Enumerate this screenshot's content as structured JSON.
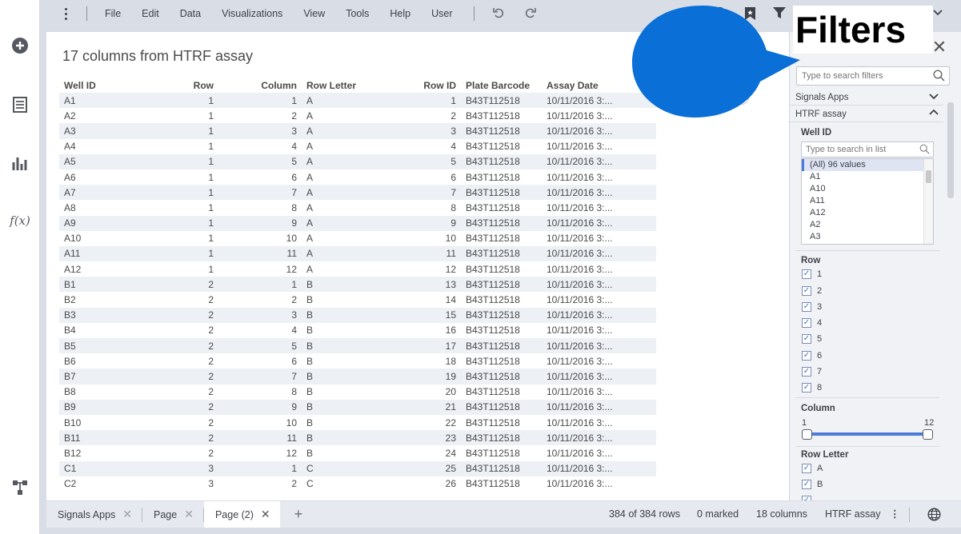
{
  "menubar": {
    "menus": [
      "File",
      "Edit",
      "Data",
      "Visualizations",
      "View",
      "Tools",
      "Help",
      "User"
    ]
  },
  "window": {
    "title": "17 columns from HTRF assay"
  },
  "table": {
    "columns": [
      "Well ID",
      "Row",
      "Column",
      "Row Letter",
      "Row ID",
      "Plate Barcode",
      "Assay Date"
    ],
    "rows": [
      [
        "A1",
        "1",
        "1",
        "A",
        "1",
        "B43T112518",
        "10/11/2016 3:..."
      ],
      [
        "A2",
        "1",
        "2",
        "A",
        "2",
        "B43T112518",
        "10/11/2016 3:..."
      ],
      [
        "A3",
        "1",
        "3",
        "A",
        "3",
        "B43T112518",
        "10/11/2016 3:..."
      ],
      [
        "A4",
        "1",
        "4",
        "A",
        "4",
        "B43T112518",
        "10/11/2016 3:..."
      ],
      [
        "A5",
        "1",
        "5",
        "A",
        "5",
        "B43T112518",
        "10/11/2016 3:..."
      ],
      [
        "A6",
        "1",
        "6",
        "A",
        "6",
        "B43T112518",
        "10/11/2016 3:..."
      ],
      [
        "A7",
        "1",
        "7",
        "A",
        "7",
        "B43T112518",
        "10/11/2016 3:..."
      ],
      [
        "A8",
        "1",
        "8",
        "A",
        "8",
        "B43T112518",
        "10/11/2016 3:..."
      ],
      [
        "A9",
        "1",
        "9",
        "A",
        "9",
        "B43T112518",
        "10/11/2016 3:..."
      ],
      [
        "A10",
        "1",
        "10",
        "A",
        "10",
        "B43T112518",
        "10/11/2016 3:..."
      ],
      [
        "A11",
        "1",
        "11",
        "A",
        "11",
        "B43T112518",
        "10/11/2016 3:..."
      ],
      [
        "A12",
        "1",
        "12",
        "A",
        "12",
        "B43T112518",
        "10/11/2016 3:..."
      ],
      [
        "B1",
        "2",
        "1",
        "B",
        "13",
        "B43T112518",
        "10/11/2016 3:..."
      ],
      [
        "B2",
        "2",
        "2",
        "B",
        "14",
        "B43T112518",
        "10/11/2016 3:..."
      ],
      [
        "B3",
        "2",
        "3",
        "B",
        "15",
        "B43T112518",
        "10/11/2016 3:..."
      ],
      [
        "B4",
        "2",
        "4",
        "B",
        "16",
        "B43T112518",
        "10/11/2016 3:..."
      ],
      [
        "B5",
        "2",
        "5",
        "B",
        "17",
        "B43T112518",
        "10/11/2016 3:..."
      ],
      [
        "B6",
        "2",
        "6",
        "B",
        "18",
        "B43T112518",
        "10/11/2016 3:..."
      ],
      [
        "B7",
        "2",
        "7",
        "B",
        "19",
        "B43T112518",
        "10/11/2016 3:..."
      ],
      [
        "B8",
        "2",
        "8",
        "B",
        "20",
        "B43T112518",
        "10/11/2016 3:..."
      ],
      [
        "B9",
        "2",
        "9",
        "B",
        "21",
        "B43T112518",
        "10/11/2016 3:..."
      ],
      [
        "B10",
        "2",
        "10",
        "B",
        "22",
        "B43T112518",
        "10/11/2016 3:..."
      ],
      [
        "B11",
        "2",
        "11",
        "B",
        "23",
        "B43T112518",
        "10/11/2016 3:..."
      ],
      [
        "B12",
        "2",
        "12",
        "B",
        "24",
        "B43T112518",
        "10/11/2016 3:..."
      ],
      [
        "C1",
        "3",
        "1",
        "C",
        "25",
        "B43T112518",
        "10/11/2016 3:..."
      ],
      [
        "C2",
        "3",
        "2",
        "C",
        "26",
        "B43T112518",
        "10/11/2016 3:..."
      ]
    ]
  },
  "filters": {
    "search_placeholder": "Type to search filters",
    "groups": [
      "Signals Apps",
      "HTRF assay"
    ],
    "well_id": {
      "title": "Well ID",
      "search_placeholder": "Type to search in list",
      "items": [
        "(All) 96 values",
        "A1",
        "A10",
        "A11",
        "A12",
        "A2",
        "A3"
      ]
    },
    "row": {
      "title": "Row",
      "items": [
        "1",
        "2",
        "3",
        "4",
        "5",
        "6",
        "7",
        "8"
      ]
    },
    "column": {
      "title": "Column",
      "min": "1",
      "max": "12"
    },
    "row_letter": {
      "title": "Row Letter",
      "items": [
        "A",
        "B"
      ]
    }
  },
  "bottombar": {
    "tabs": [
      "Signals Apps",
      "Page",
      "Page (2)"
    ],
    "active_tab": "Page (2)",
    "rows_status": "384 of 384 rows",
    "marked_status": "0 marked",
    "columns_status": "18 columns",
    "table_name": "HTRF assay"
  },
  "callout": {
    "label": "Filters",
    "color": "#0a6fd6"
  },
  "icons": [
    "add-icon",
    "data-table-icon",
    "bar-chart-icon",
    "fx-icon",
    "network-icon",
    "kebab-menu-icon",
    "undo-icon",
    "redo-icon",
    "search-icon",
    "bookmark-icon",
    "filter-icon",
    "close-icon",
    "chevron-down-icon",
    "chevron-up-icon",
    "globe-icon"
  ]
}
